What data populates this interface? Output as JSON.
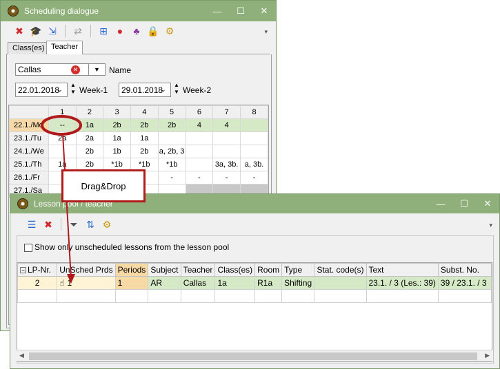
{
  "scheduling": {
    "title": "Scheduling dialogue",
    "controls": {
      "minimize": "—",
      "maximize": "☐",
      "close": "✕"
    },
    "tabs": [
      "Class(es)",
      "Teacher"
    ],
    "teacher_value": "Callas",
    "name_label": "Name",
    "week1_date": "22.01.2018",
    "week1_label": "Week-1",
    "week2_date": "29.01.2018",
    "week2_label": "Week-2",
    "periods": [
      "1",
      "2",
      "3",
      "4",
      "5",
      "6",
      "7",
      "8"
    ],
    "rows": [
      {
        "day": "22.1./Mo",
        "cells": [
          "--",
          "1a",
          "2b",
          "2b",
          "2b",
          "4",
          "4",
          ""
        ]
      },
      {
        "day": "23.1./Tu",
        "cells": [
          "2a",
          "2a",
          "1a",
          "1a",
          "",
          "",
          "",
          ""
        ]
      },
      {
        "day": "24.1./We",
        "cells": [
          "",
          "2b",
          "1b",
          "2b",
          "a, 2b, 3",
          "",
          "",
          ""
        ]
      },
      {
        "day": "25.1./Th",
        "cells": [
          "1a",
          "2b",
          "*1b",
          "*1b",
          "*1b",
          "",
          "3a, 3b.",
          "a, 3b."
        ]
      },
      {
        "day": "26.1./Fr",
        "cells": [
          "",
          "",
          "",
          "",
          "-",
          "-",
          "-",
          "-"
        ]
      },
      {
        "day": "27.1./Sa",
        "cells": [
          "",
          "",
          "",
          "",
          "",
          "",
          "",
          ""
        ]
      }
    ]
  },
  "callout": {
    "text": "Drag&Drop"
  },
  "pool": {
    "title": "Lesson pool / teacher",
    "checkbox_label": "Show only unscheduled lessons from the lesson pool",
    "columns": [
      "LP-Nr.",
      "UnSched Prds",
      "Periods",
      "Subject",
      "Teacher",
      "Class(es)",
      "Room",
      "Type",
      "Stat. code(s)",
      "Text",
      "Subst. No."
    ],
    "rows": [
      {
        "lp_nr": "2",
        "unsched": "1",
        "periods": "1",
        "subject": "AR",
        "teacher": "Callas",
        "classes": "1a",
        "room": "R1a",
        "type": "Shifting",
        "stat": "",
        "text": "23.1. / 3 (Les.: 39)",
        "subst": "39 / 23.1. / 3"
      }
    ]
  },
  "colors": {
    "titlebar": "#8fb07a",
    "highlight_row": "#d6e9c6",
    "callout_border": "#b01a1a"
  }
}
